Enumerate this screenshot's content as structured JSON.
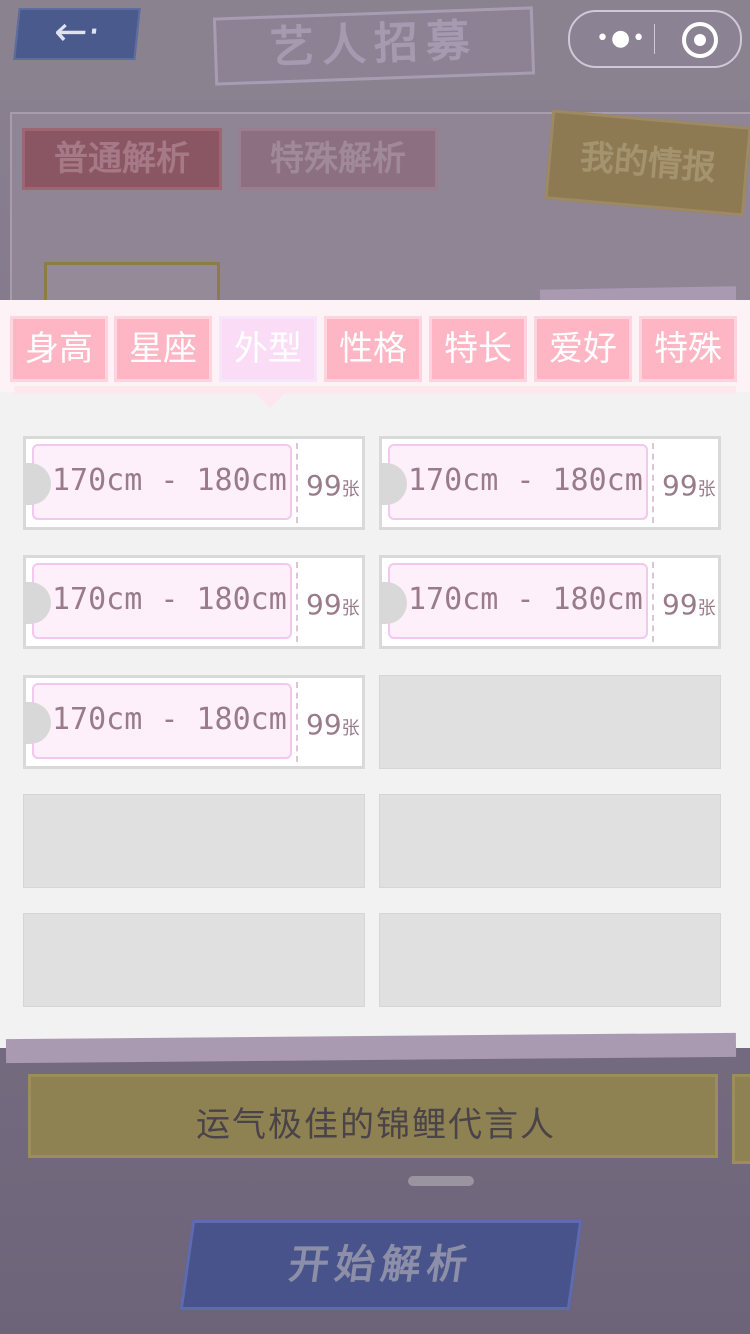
{
  "header": {
    "back_icon": "←·",
    "title": "艺人招募",
    "capsule_dots": "•●•"
  },
  "bg_tabs": {
    "normal": "普通解析",
    "special": "特殊解析",
    "my_info": "我的情报"
  },
  "categories": [
    "身高",
    "星座",
    "外型",
    "性格",
    "特长",
    "爱好",
    "特殊"
  ],
  "active_category": "外型",
  "tickets": [
    {
      "range": "170cm - 180cm",
      "count": "99",
      "unit": "张"
    },
    {
      "range": "170cm - 180cm",
      "count": "99",
      "unit": "张"
    },
    {
      "range": "170cm - 180cm",
      "count": "99",
      "unit": "张"
    },
    {
      "range": "170cm - 180cm",
      "count": "99",
      "unit": "张"
    },
    {
      "range": "170cm - 180cm",
      "count": "99",
      "unit": "张"
    }
  ],
  "bottom": {
    "ticket_label": "运气极佳的锦鲤代言人",
    "start_button": "开始解析"
  }
}
